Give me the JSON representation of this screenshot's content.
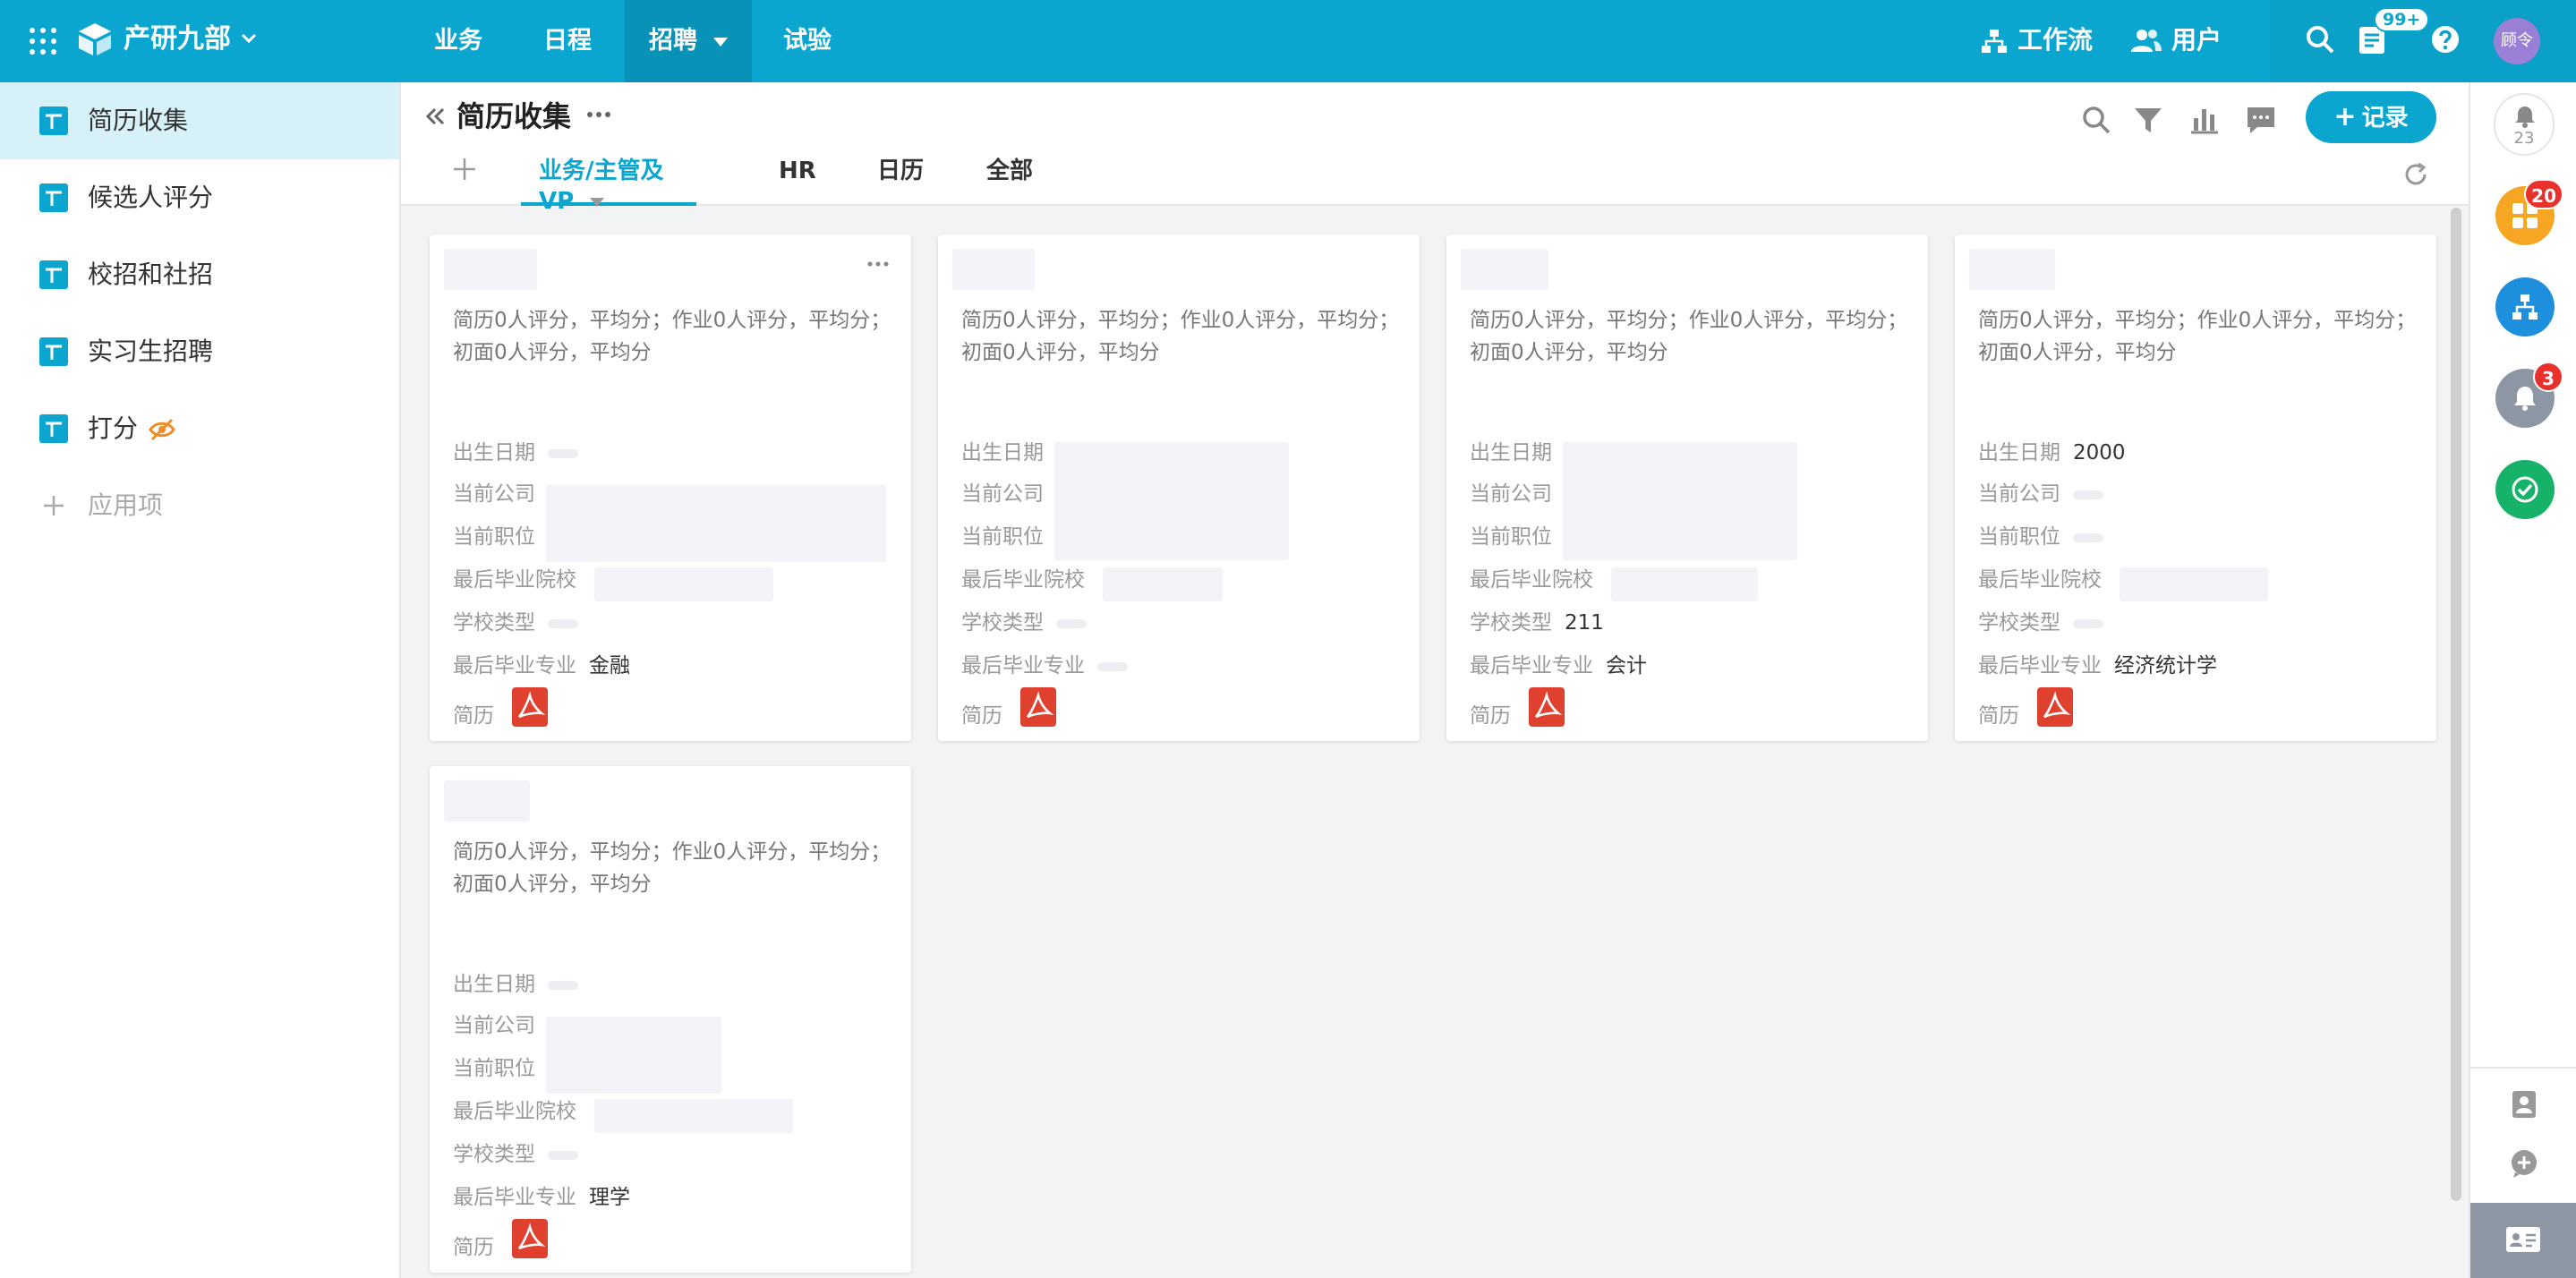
{
  "topbar": {
    "org_name": "产研九部",
    "nav": [
      "业务",
      "日程",
      "招聘",
      "试验"
    ],
    "active_nav": "招聘",
    "workflow_label": "工作流",
    "users_label": "用户",
    "badge": "99+",
    "avatar_text": "顾令"
  },
  "sidebar": {
    "items": [
      "简历收集",
      "候选人评分",
      "校招和社招",
      "实习生招聘",
      "打分"
    ],
    "active": "简历收集",
    "add_label": "应用项"
  },
  "header": {
    "title": "简历收集",
    "record_label": "记录",
    "views": [
      "业务/主管及VP",
      "HR",
      "日历",
      "全部"
    ],
    "active_view": "业务/主管及VP"
  },
  "field_labels": {
    "birth": "出生日期",
    "company": "当前公司",
    "position": "当前职位",
    "school": "最后毕业院校",
    "school_type": "学校类型",
    "major": "最后毕业专业",
    "resume": "简历"
  },
  "cards": [
    {
      "summary": "简历0人评分，平均分；作业0人评分，平均分；初面0人评分，平均分",
      "birth": "",
      "school_type": "",
      "major": "金融"
    },
    {
      "summary": "简历0人评分，平均分；作业0人评分，平均分；初面0人评分，平均分",
      "birth": "",
      "school_type": "",
      "major": ""
    },
    {
      "summary": "简历0人评分，平均分；作业0人评分，平均分；初面0人评分，平均分",
      "birth": "",
      "school_type": "211",
      "major": "会计"
    },
    {
      "summary": "简历0人评分，平均分；作业0人评分，平均分；初面0人评分，平均分",
      "birth": "2000",
      "school_type": "",
      "major": "经济统计学"
    },
    {
      "summary": "简历0人评分，平均分；作业0人评分，平均分；初面0人评分，平均分",
      "birth": "",
      "school_type": "",
      "major": "理学"
    }
  ],
  "right_rail": {
    "notification_count": "23",
    "app_badges": [
      "20",
      "3"
    ]
  },
  "colors": {
    "primary": "#0aa6cf",
    "orange_app": "#f6a623",
    "blue_app": "#1e8fdc",
    "gray_app": "#8d96a3",
    "green_app": "#17b26a",
    "pdf_red": "#e0412f"
  }
}
